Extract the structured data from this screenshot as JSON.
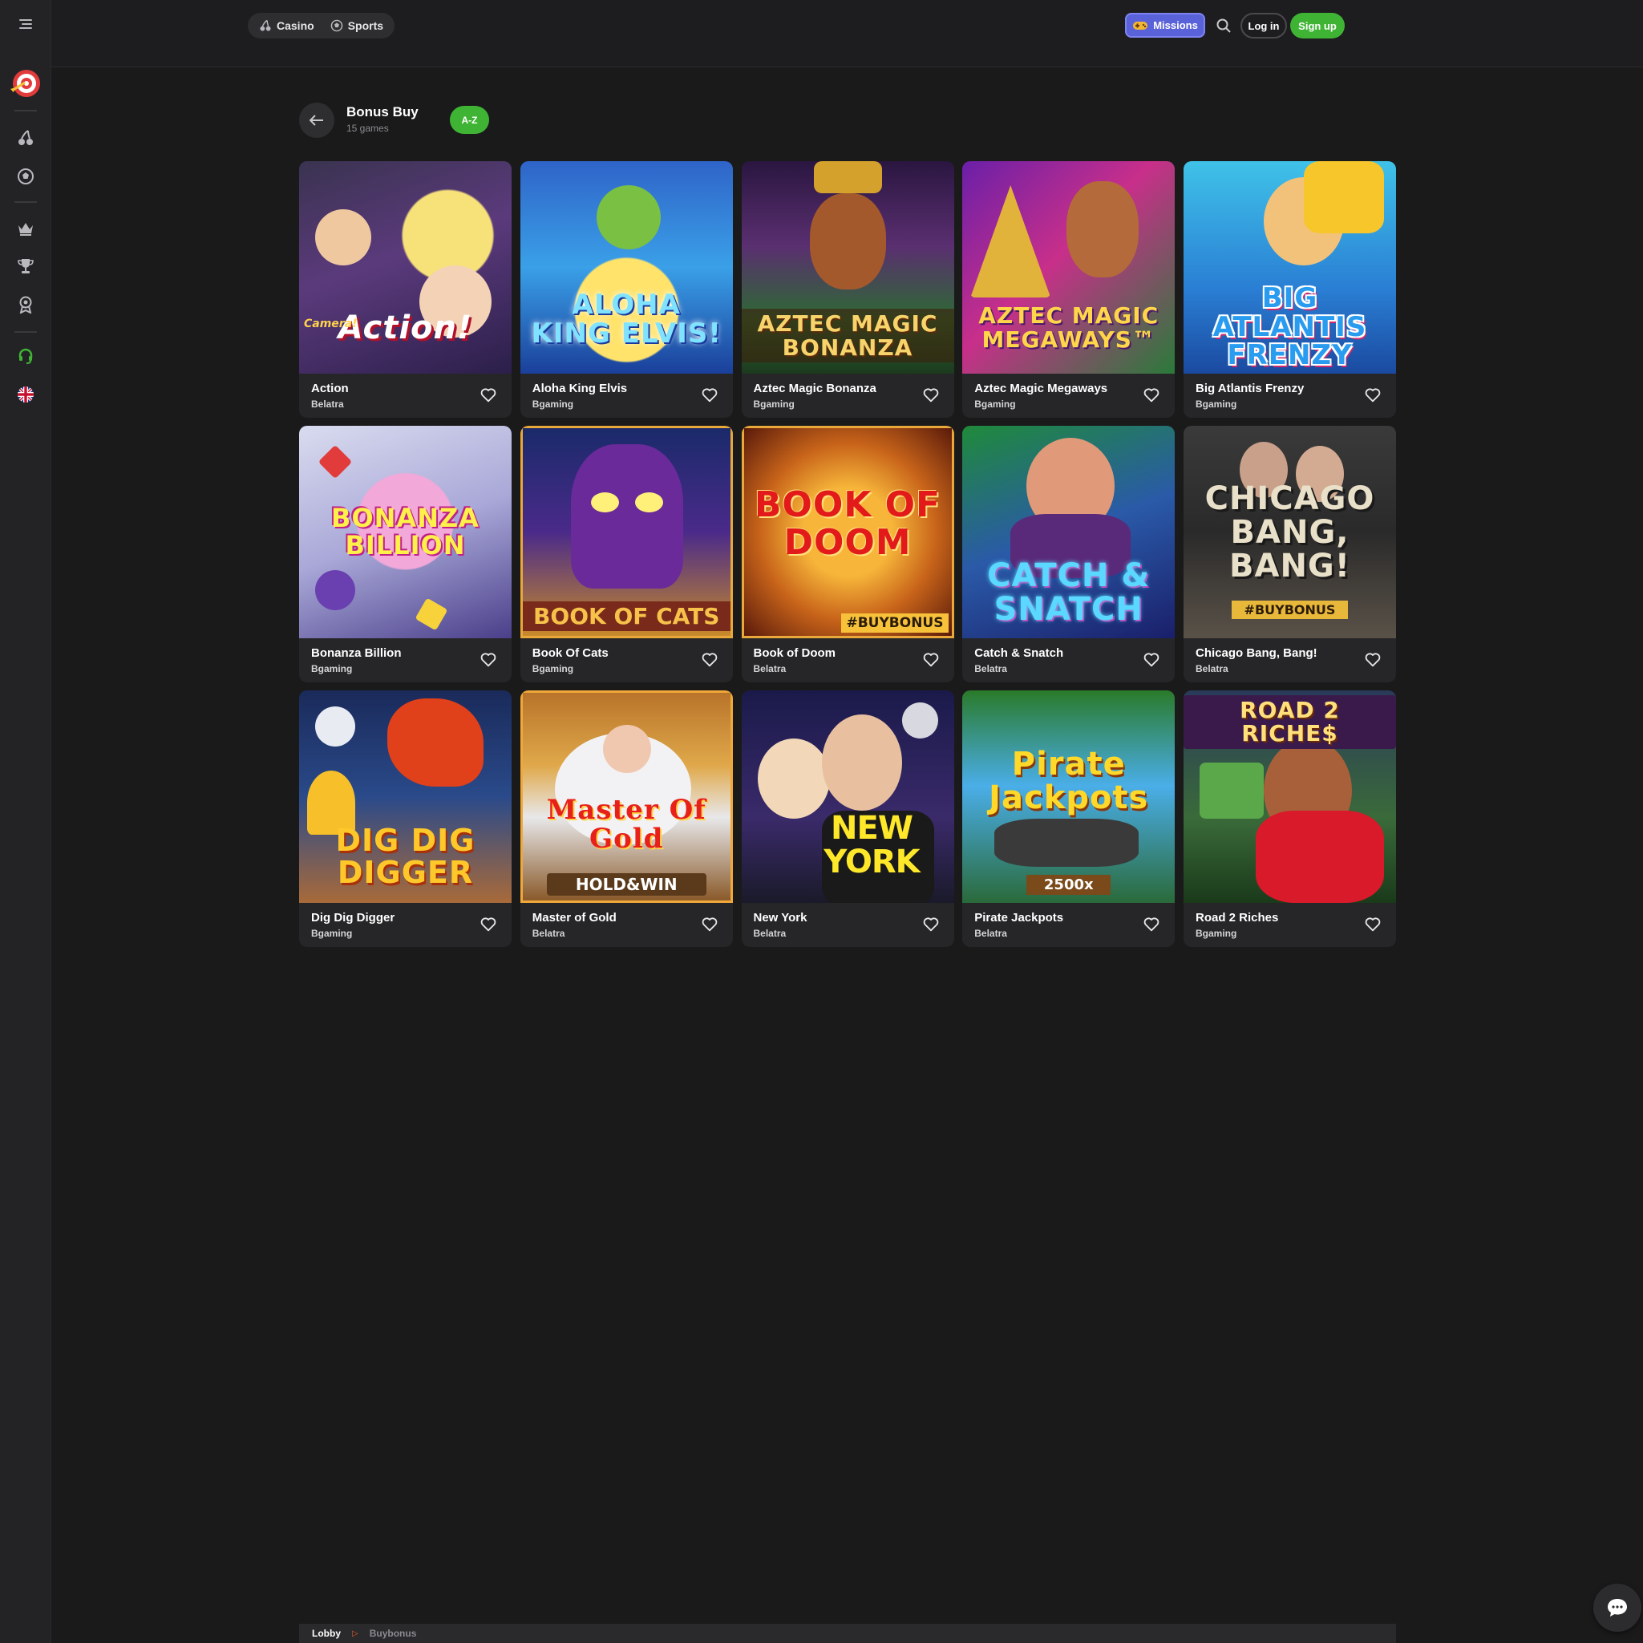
{
  "header": {
    "nav": [
      {
        "label": "Casino",
        "icon": "cherry-icon"
      },
      {
        "label": "Sports",
        "icon": "soccer-ball-icon"
      }
    ],
    "missions_label": "Missions",
    "login_label": "Log in",
    "signup_label": "Sign up"
  },
  "category": {
    "title": "Bonus Buy",
    "count": "15 games",
    "sort_label": "A-Z"
  },
  "games": [
    {
      "name": "Action",
      "provider": "Belatra",
      "art": "Action!",
      "art_sub": "Camera!"
    },
    {
      "name": "Aloha King Elvis",
      "provider": "Bgaming",
      "art": "Aloha King Elvis!",
      "art_sub": ""
    },
    {
      "name": "Aztec Magic Bonanza",
      "provider": "Bgaming",
      "art": "Aztec Magic Bonanza",
      "art_sub": ""
    },
    {
      "name": "Aztec Magic Megaways",
      "provider": "Bgaming",
      "art": "Aztec Magic Megaways™",
      "art_sub": ""
    },
    {
      "name": "Big Atlantis Frenzy",
      "provider": "Bgaming",
      "art": "Big Atlantis Frenzy",
      "art_sub": ""
    },
    {
      "name": "Bonanza Billion",
      "provider": "Bgaming",
      "art": "Bonanza Billion",
      "art_sub": ""
    },
    {
      "name": "Book Of Cats",
      "provider": "Bgaming",
      "art": "Book of Cats",
      "art_sub": ""
    },
    {
      "name": "Book of Doom",
      "provider": "Belatra",
      "art": "Book of Doom",
      "art_sub": "#BUYBONUS"
    },
    {
      "name": "Catch & Snatch",
      "provider": "Belatra",
      "art": "Catch & Snatch",
      "art_sub": ""
    },
    {
      "name": "Chicago Bang, Bang!",
      "provider": "Belatra",
      "art": "Chicago Bang, Bang!",
      "art_sub": "#BUYBONUS"
    },
    {
      "name": "Dig Dig Digger",
      "provider": "Bgaming",
      "art": "Dig Dig Digger",
      "art_sub": ""
    },
    {
      "name": "Master of Gold",
      "provider": "Belatra",
      "art": "Master Of Gold",
      "art_sub": "HOLD&WIN"
    },
    {
      "name": "New York",
      "provider": "Belatra",
      "art": "New York",
      "art_sub": ""
    },
    {
      "name": "Pirate Jackpots",
      "provider": "Belatra",
      "art": "Pirate Jackpots",
      "art_sub": "2500x"
    },
    {
      "name": "Road 2 Riches",
      "provider": "Bgaming",
      "art": "Road 2 Riche$",
      "art_sub": ""
    }
  ],
  "breadcrumb": {
    "lobby": "Lobby",
    "current": "Buybonus"
  },
  "colors": {
    "accent_green": "#3fb434",
    "missions_purple": "#5a62d9",
    "background": "#1a1a1b",
    "card": "#262628"
  }
}
